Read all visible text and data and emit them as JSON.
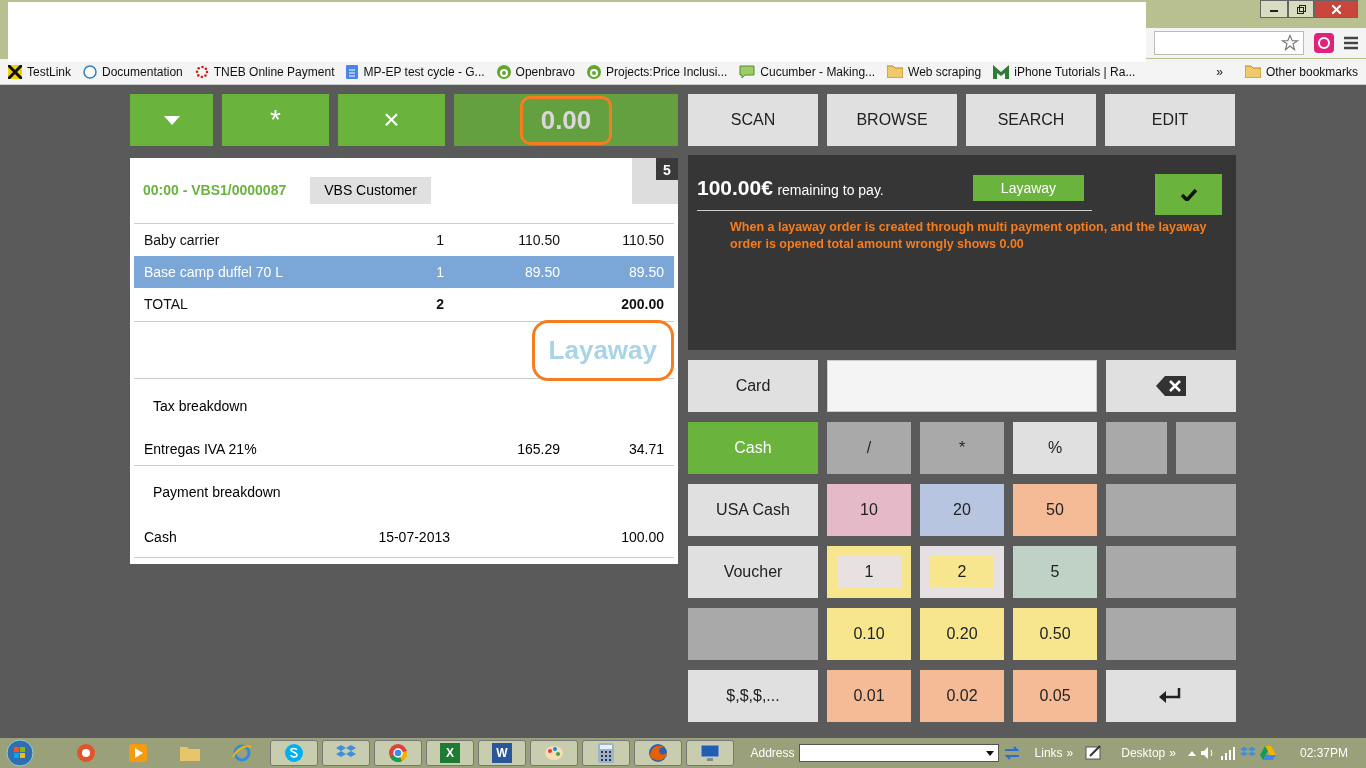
{
  "browser": {
    "bookmarks": [
      {
        "label": "TestLink",
        "kind": "hazard"
      },
      {
        "label": "Documentation",
        "kind": "ring"
      },
      {
        "label": "TNEB Online Payment",
        "kind": "dots"
      },
      {
        "label": "MP-EP test cycle - G...",
        "kind": "doc"
      },
      {
        "label": "Openbravo",
        "kind": "brand"
      },
      {
        "label": "Projects:Price Inclusi...",
        "kind": "brand"
      },
      {
        "label": "Cucumber - Making...",
        "kind": "chat"
      },
      {
        "label": "Web scraping",
        "kind": "folder"
      },
      {
        "label": "iPhone Tutorials | Ra...",
        "kind": "m"
      }
    ],
    "overflow": "»",
    "other_bookmarks": "Other bookmarks"
  },
  "toolbar": {
    "actions": [
      {
        "kind": "caret"
      },
      {
        "kind": "text",
        "label": "*"
      },
      {
        "kind": "text",
        "label": "×"
      }
    ],
    "total": "0.00",
    "total_highlighted": true
  },
  "nav_buttons": [
    "SCAN",
    "BROWSE",
    "SEARCH",
    "EDIT"
  ],
  "receipt": {
    "order_id": "00:00 - VBS1/0000087",
    "customer": "VBS Customer",
    "count": "5",
    "lines": [
      {
        "name": "Baby carrier",
        "qty": "1",
        "price": "110.50",
        "total": "110.50",
        "selected": false
      },
      {
        "name": "Base camp duffel 70 L",
        "qty": "1",
        "price": "89.50",
        "total": "89.50",
        "selected": true
      }
    ],
    "total": {
      "label": "TOTAL",
      "qty": "2",
      "amount": "200.00"
    },
    "status": "Layaway",
    "status_highlighted": true,
    "tax_heading": "Tax breakdown",
    "taxes": [
      {
        "name": "Entregas IVA 21%",
        "base": "165.29",
        "amount": "34.71"
      }
    ],
    "payment_heading": "Payment breakdown",
    "payments": [
      {
        "name": "Cash",
        "date": "15-07-2013",
        "amount": "100.00"
      }
    ]
  },
  "payment": {
    "amount": "100.00€",
    "remaining": "remaining to pay.",
    "layaway_button": "Layaway",
    "note": "When a layaway order is created through multi payment option, and the layaway order is opened total amount wrongly shows 0.00"
  },
  "keypad": {
    "rows": [
      [
        {
          "kind": "method",
          "label": "Card",
          "color": "#e0e0e0"
        },
        {
          "kind": "field"
        },
        {
          "kind": "backspace",
          "color": "#e0e0e0"
        }
      ],
      [
        {
          "kind": "method",
          "label": "Cash",
          "color": "#6ab33d"
        },
        {
          "kind": "key",
          "label": "/",
          "color": "#a9a9a9"
        },
        {
          "kind": "key",
          "label": "*",
          "color": "#a9a9a9"
        },
        {
          "kind": "key",
          "label": "%",
          "color": "#e0e0e0"
        },
        {
          "kind": "blank",
          "color": "#a9a9a9"
        },
        {
          "kind": "blank",
          "color": "#a9a9a9"
        }
      ],
      [
        {
          "kind": "method",
          "label": "USA Cash",
          "color": "#e0e0e0"
        },
        {
          "kind": "key",
          "label": "10",
          "color": "#e6b9c8"
        },
        {
          "kind": "key",
          "label": "20",
          "color": "#b8c5e0"
        },
        {
          "kind": "key",
          "label": "50",
          "color": "#f4bb96"
        },
        {
          "kind": "wide",
          "color": "#a9a9a9"
        }
      ],
      [
        {
          "kind": "method",
          "label": "Voucher",
          "color": "#e0e0e0"
        },
        {
          "kind": "coin",
          "label": "1",
          "color": "#f7e68e",
          "chip": {
            "color": "#e8e1e2"
          }
        },
        {
          "kind": "coin",
          "label": "2",
          "color": "#e5e1e2",
          "chip": {
            "color": "#f7e68e"
          }
        },
        {
          "kind": "key",
          "label": "5",
          "color": "#bfd2c5"
        },
        {
          "kind": "wide",
          "color": "#a9a9a9"
        }
      ],
      [
        {
          "kind": "blank",
          "color": "#a9a9a9"
        },
        {
          "kind": "key",
          "label": "0.10",
          "color": "#f7e68e"
        },
        {
          "kind": "key",
          "label": "0.20",
          "color": "#f7e68e"
        },
        {
          "kind": "key",
          "label": "0.50",
          "color": "#f7e68e"
        },
        {
          "kind": "wide",
          "color": "#a9a9a9"
        }
      ],
      [
        {
          "kind": "method",
          "label": "$,$,$,...",
          "color": "#e0e0e0"
        },
        {
          "kind": "key",
          "label": "0.01",
          "color": "#f4bb96"
        },
        {
          "kind": "key",
          "label": "0.02",
          "color": "#f4bb96"
        },
        {
          "kind": "key",
          "label": "0.05",
          "color": "#f4bb96"
        },
        {
          "kind": "enter",
          "color": "#e0e0e0"
        }
      ]
    ]
  },
  "taskbar": {
    "apps": [
      {
        "kind": "m",
        "running": false
      },
      {
        "kind": "player",
        "running": false
      },
      {
        "kind": "folder",
        "running": false
      },
      {
        "kind": "ie",
        "running": false
      },
      {
        "kind": "skype",
        "running": true
      },
      {
        "kind": "box",
        "running": true
      },
      {
        "kind": "chrome",
        "running": true
      },
      {
        "kind": "letter",
        "label": "X",
        "color": "#1e7b34",
        "running": true
      },
      {
        "kind": "letter",
        "label": "W",
        "color": "#2b579a",
        "running": true
      },
      {
        "kind": "paint",
        "running": true
      },
      {
        "kind": "calc",
        "running": true
      },
      {
        "kind": "firefox",
        "running": true
      },
      {
        "kind": "monitor",
        "running": true
      }
    ],
    "address_label": "Address",
    "links": "Links",
    "links_more": "»",
    "desktop": "Desktop",
    "desktop_more": "»",
    "time": "02:37PM"
  }
}
